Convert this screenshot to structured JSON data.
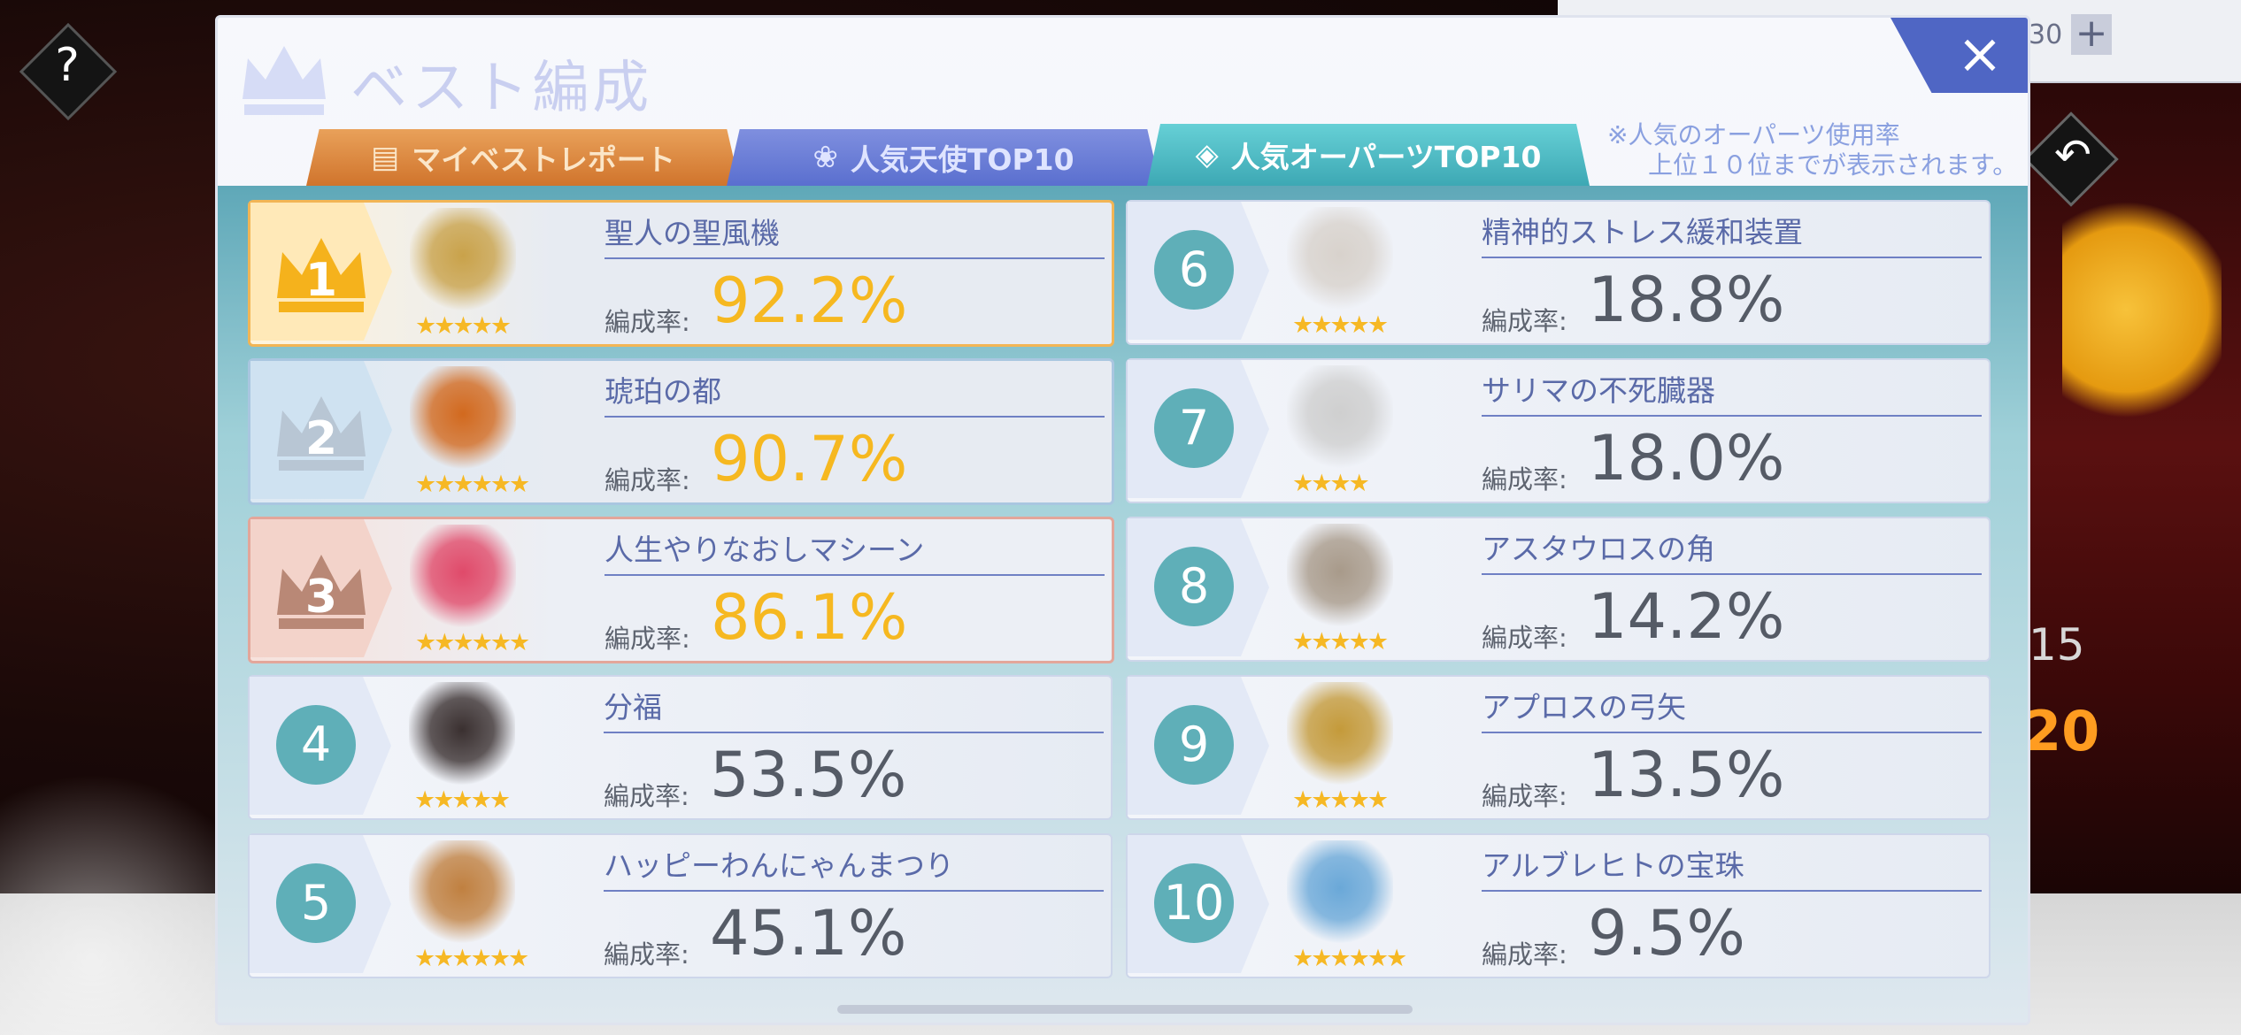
{
  "header": {
    "title": "ベスト編成",
    "close_label": "×"
  },
  "tabs": [
    {
      "label": "マイベストレポート",
      "icon": "report-icon",
      "active": false
    },
    {
      "label": "人気天使TOP10",
      "icon": "angel-icon",
      "active": false
    },
    {
      "label": "人気オーパーツTOP10",
      "icon": "gem-icon",
      "active": true
    }
  ],
  "note": [
    "※人気のオーパーツ使用率",
    "上位１０位までが表示されます。"
  ],
  "rate_label": "編成率:",
  "items": [
    {
      "rank": "1",
      "name": "聖人の聖風機",
      "rate": "92.2%",
      "stars": "★★★★★",
      "star_count": 5
    },
    {
      "rank": "2",
      "name": "琥珀の都",
      "rate": "90.7%",
      "stars": "★★★★★★",
      "star_count": 6
    },
    {
      "rank": "3",
      "name": "人生やりなおしマシーン",
      "rate": "86.1%",
      "stars": "★★★★★★",
      "star_count": 6
    },
    {
      "rank": "4",
      "name": "分福",
      "rate": "53.5%",
      "stars": "★★★★★",
      "star_count": 5
    },
    {
      "rank": "5",
      "name": "ハッピーわんにゃんまつり",
      "rate": "45.1%",
      "stars": "★★★★★★",
      "star_count": 6
    },
    {
      "rank": "6",
      "name": "精神的ストレス緩和装置",
      "rate": "18.8%",
      "stars": "★★★★★",
      "star_count": 5
    },
    {
      "rank": "7",
      "name": "サリマの不死臓器",
      "rate": "18.0%",
      "stars": "★★★★",
      "star_count": 4
    },
    {
      "rank": "8",
      "name": "アスタウロスの角",
      "rate": "14.2%",
      "stars": "★★★★★",
      "star_count": 5
    },
    {
      "rank": "9",
      "name": "アプロスの弓矢",
      "rate": "13.5%",
      "stars": "★★★★★",
      "star_count": 5
    },
    {
      "rank": "10",
      "name": "アルブレヒトの宝珠",
      "rate": "9.5%",
      "stars": "★★★★★★",
      "star_count": 6
    }
  ],
  "background": {
    "top_value": "30",
    "side_values": [
      "15",
      "20"
    ]
  },
  "colors": {
    "accent_blue": "#4f66c4",
    "teal": "#5fafb8",
    "gold_rate": "#f6b820"
  }
}
